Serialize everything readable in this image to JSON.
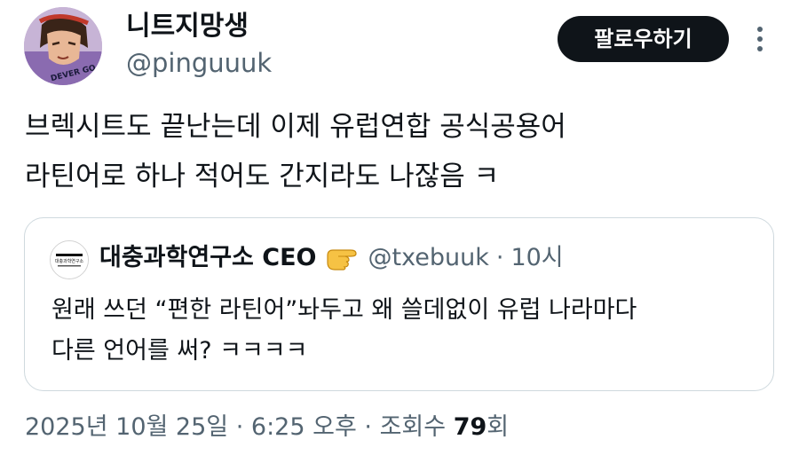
{
  "author": {
    "display_name": "니트지망생",
    "handle": "@pinguuuk",
    "avatar_icon": "anime-character-avatar",
    "avatar_text": "DEVER GO"
  },
  "actions": {
    "follow_label": "팔로우하기",
    "more_icon": "more-vertical-icon"
  },
  "tweet": {
    "lines": [
      "브렉시트도 끝난는데 이제 유럽연합 공식공용어",
      "라틴어로 하나 적어도 간지라도 나잖음 ㅋ"
    ]
  },
  "quote": {
    "display_name": "대충과학연구소 CEO",
    "emoji": "pointing-hand-emoji",
    "handle": "@txebuuk",
    "separator": "·",
    "time": "10시",
    "avatar_text": "대충과학연구소",
    "lines": [
      "원래 쓰던 “편한 라틴어”놔두고 왜 쓸데없이 유럽 나라마다",
      "다른 언어를 써? ㅋㅋㅋㅋ"
    ]
  },
  "meta": {
    "date": "2025년 10월 25일",
    "sep1": "·",
    "time": "6:25 오후",
    "sep2": "·",
    "views_label": "조회수",
    "views_count": "79",
    "views_suffix": "회"
  },
  "colors": {
    "text_primary": "#0f1419",
    "text_secondary": "#536471",
    "border": "#cfd9de",
    "follow_bg": "#0f1419"
  }
}
